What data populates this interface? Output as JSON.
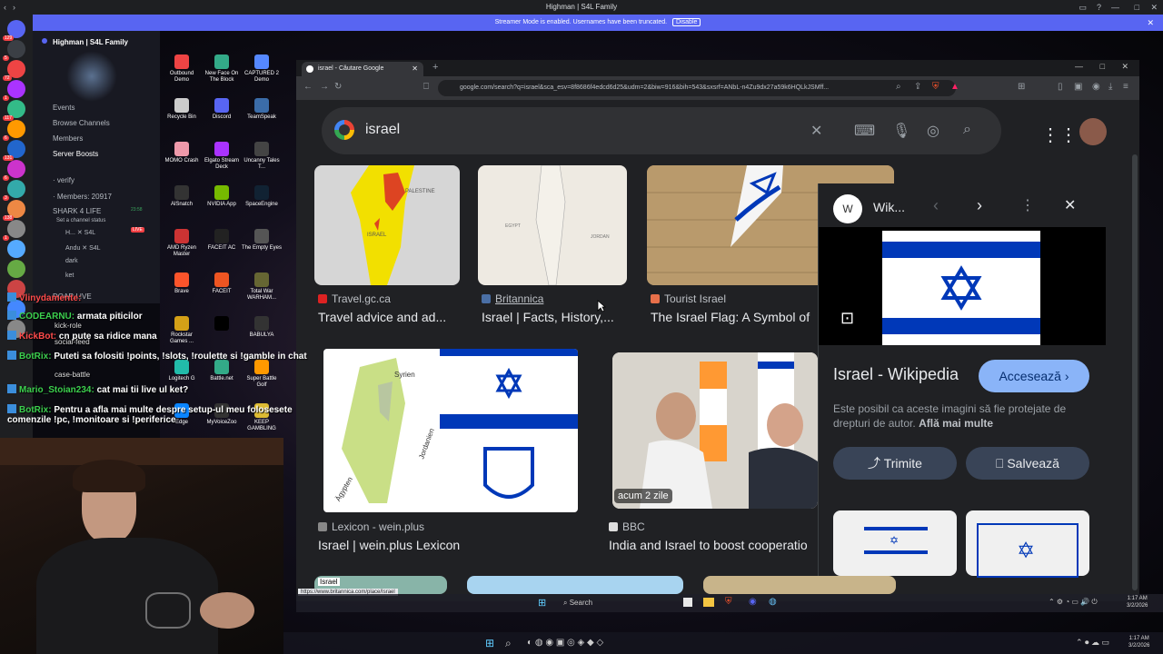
{
  "discord": {
    "title": "Highman | S4L Family",
    "streamer_msg": "Streamer Mode is enabled. Usernames have been truncated.",
    "disable_label": "Disable",
    "server_name": "Highman | S4L Family",
    "channels": [
      "Events",
      "Browse Channels",
      "Members",
      "Server Boosts",
      "· verify",
      "· Members: 20917",
      "SHARK 4 LIFE",
      "Set a channel status",
      "H... ✕ S4L",
      "Andu ✕ S4L",
      "dark",
      "ket",
      "DOAR LIVE"
    ],
    "live_badge": "LIVE",
    "voice_time": "23:58",
    "badges": [
      "129",
      "5",
      "72",
      "1",
      "117",
      "6",
      "131",
      "6",
      "3",
      "138",
      "1"
    ]
  },
  "desktop": {
    "icons": [
      "Outbound Demo",
      "New Face On The Block",
      "CAPTURED 2 Demo",
      "Recycle Bin",
      "Discord",
      "TeamSpeak",
      "MOMO Crash",
      "Elgato Stream Deck",
      "Uncanny Tales T...",
      "AlSnatch",
      "NVIDIA App",
      "SpaceEngine",
      "AMD Ryzen Master",
      "FACEIT AC",
      "The Empty Eyes",
      "Brave",
      "FACEIT",
      "Total War WARHAM...",
      "Rockstar Games ...",
      "",
      "BABULYA",
      "Logitech G",
      "Battle.net",
      "Super Battle Golf",
      "Edge",
      "MyVoiceZoo",
      "KEEP GAMBLING"
    ]
  },
  "browser": {
    "tab_title": "israel - Căutare Google",
    "url": "google.com/search?q=israel&sca_esv=8f8686f4edcd6d25&udm=2&biw=916&bih=543&sxsrf=ANbL-n4Zu9dx27a59k6HQLkJSMff...",
    "query": "israel",
    "status_url": "https://www.britannica.com/place/Israel"
  },
  "results": [
    {
      "source": "Travel.gc.ca",
      "title": "Travel advice and ad..."
    },
    {
      "source": "Britannica",
      "title": "Israel | Facts, History,..."
    },
    {
      "source": "Tourist Israel",
      "title": "The Israel Flag: A Symbol of"
    },
    {
      "source": "Lexicon - wein.plus",
      "title": "Israel | wein.plus Lexicon"
    },
    {
      "source": "BBC",
      "title": "India and Israel to boost cooperatio"
    }
  ],
  "map_labels": {
    "palestine": "PALESTINE",
    "israel": "ISRAEL",
    "egypt": "EGYPT",
    "jordan": "JORDAN",
    "syrien": "Syrien",
    "jordanien": "Jordanien",
    "agypten": "Ägypten",
    "lexicon_tag": "Israel"
  },
  "bbc_badge": "acum 2 zile",
  "panel": {
    "site": "Wik...",
    "title": "Israel - Wikipedia",
    "visit": "Accesează",
    "copyright": "Este posibil ca aceste imagini să fie protejate de drepturi de autor.",
    "learn_more": "Află mai multe",
    "share": "Trimite",
    "save": "Salvează"
  },
  "chat": [
    {
      "user": "Vlinydamente:",
      "msg": ""
    },
    {
      "user": "CODEARNU:",
      "msg": "armata piticilor"
    },
    {
      "user": "KickBot:",
      "msg": "cn pute sa ridice mana"
    },
    {
      "user": "BotRix:",
      "msg": "Puteti sa folositi !points, !slots, !roulette si !gamble in chat"
    },
    {
      "user": "Mario_Stoian234:",
      "msg": "cat mai tii live ul ket?"
    },
    {
      "user": "BotRix:",
      "msg": "Pentru a afla mai multe despre setup-ul meu folosesete comenzile !pc, !monitoare si !periferice"
    }
  ],
  "chat_overlay_extra": [
    "kick-role",
    "social-feed",
    "case-battle"
  ],
  "taskbar": {
    "search": "Search",
    "time1": "1:17 AM",
    "date1": "3/2/2026",
    "time2": "1:17 AM",
    "date2": "3/2/2026"
  }
}
